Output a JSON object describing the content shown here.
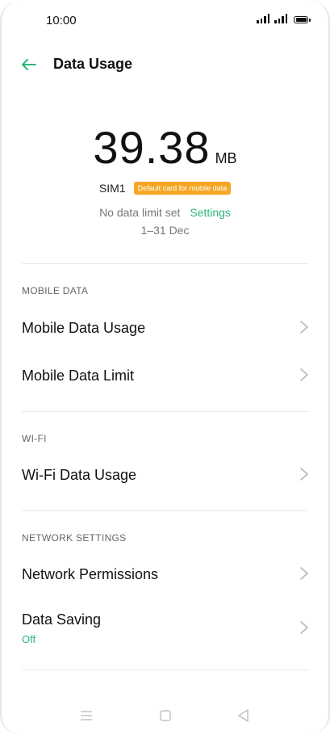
{
  "status_bar": {
    "time": "10:00"
  },
  "header": {
    "title": "Data Usage"
  },
  "summary": {
    "usage_value": "39.38",
    "usage_unit": "MB",
    "sim_label": "SIM1",
    "sim_badge": "Default card for mobile data",
    "limit_text": "No data limit set",
    "settings_link": "Settings",
    "period": "1–31 Dec"
  },
  "sections": {
    "mobile_data": {
      "header": "MOBILE DATA",
      "items": [
        {
          "label": "Mobile Data Usage"
        },
        {
          "label": "Mobile Data Limit"
        }
      ]
    },
    "wifi": {
      "header": "WI-FI",
      "items": [
        {
          "label": "Wi-Fi Data Usage"
        }
      ]
    },
    "network_settings": {
      "header": "NETWORK SETTINGS",
      "items": [
        {
          "label": "Network Permissions"
        },
        {
          "label": "Data Saving",
          "sub": "Off"
        }
      ]
    }
  },
  "colors": {
    "accent": "#2fb57a",
    "badge": "#f5a623"
  },
  "icons": {
    "back": "arrow-left-icon",
    "chevron": "chevron-right-icon",
    "nav": [
      "menu-icon",
      "home-icon",
      "back-triangle-icon"
    ]
  }
}
